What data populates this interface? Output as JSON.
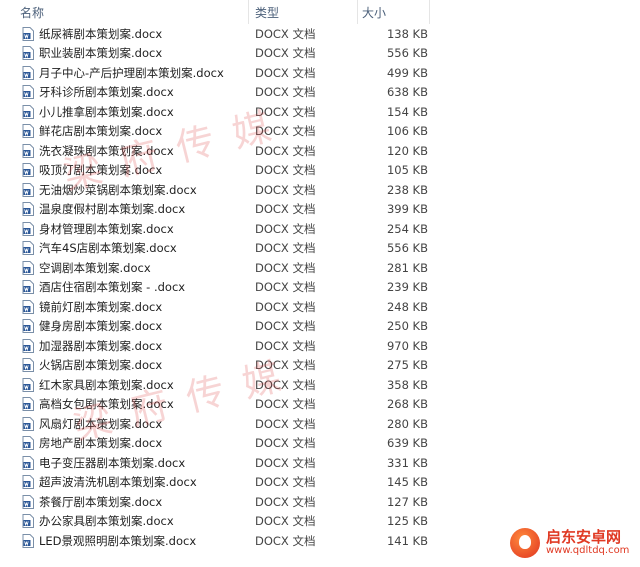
{
  "columns": {
    "name": "名称",
    "type": "类型",
    "size": "大小"
  },
  "files": [
    {
      "name": "纸尿裤剧本策划案.docx",
      "type": "DOCX 文档",
      "size": "138 KB"
    },
    {
      "name": "职业装剧本策划案.docx",
      "type": "DOCX 文档",
      "size": "556 KB"
    },
    {
      "name": "月子中心-产后护理剧本策划案.docx",
      "type": "DOCX 文档",
      "size": "499 KB"
    },
    {
      "name": "牙科诊所剧本策划案.docx",
      "type": "DOCX 文档",
      "size": "638 KB"
    },
    {
      "name": "小儿推拿剧本策划案.docx",
      "type": "DOCX 文档",
      "size": "154 KB"
    },
    {
      "name": "鲜花店剧本策划案.docx",
      "type": "DOCX 文档",
      "size": "106 KB"
    },
    {
      "name": "洗衣凝珠剧本策划案.docx",
      "type": "DOCX 文档",
      "size": "120 KB"
    },
    {
      "name": "吸顶灯剧本策划案.docx",
      "type": "DOCX 文档",
      "size": "105 KB"
    },
    {
      "name": "无油烟炒菜锅剧本策划案.docx",
      "type": "DOCX 文档",
      "size": "238 KB"
    },
    {
      "name": "温泉度假村剧本策划案.docx",
      "type": "DOCX 文档",
      "size": "399 KB"
    },
    {
      "name": "身材管理剧本策划案.docx",
      "type": "DOCX 文档",
      "size": "254 KB"
    },
    {
      "name": "汽车4S店剧本策划案.docx",
      "type": "DOCX 文档",
      "size": "556 KB"
    },
    {
      "name": "空调剧本策划案.docx",
      "type": "DOCX 文档",
      "size": "281 KB"
    },
    {
      "name": "酒店住宿剧本策划案 - .docx",
      "type": "DOCX 文档",
      "size": "239 KB"
    },
    {
      "name": "镜前灯剧本策划案.docx",
      "type": "DOCX 文档",
      "size": "248 KB"
    },
    {
      "name": "健身房剧本策划案.docx",
      "type": "DOCX 文档",
      "size": "250 KB"
    },
    {
      "name": "加湿器剧本策划案.docx",
      "type": "DOCX 文档",
      "size": "970 KB"
    },
    {
      "name": "火锅店剧本策划案.docx",
      "type": "DOCX 文档",
      "size": "275 KB"
    },
    {
      "name": "红木家具剧本策划案.docx",
      "type": "DOCX 文档",
      "size": "358 KB"
    },
    {
      "name": "高档女包剧本策划案.docx",
      "type": "DOCX 文档",
      "size": "268 KB"
    },
    {
      "name": "风扇灯剧本策划案.docx",
      "type": "DOCX 文档",
      "size": "280 KB"
    },
    {
      "name": "房地产剧本策划案.docx",
      "type": "DOCX 文档",
      "size": "639 KB"
    },
    {
      "name": "电子变压器剧本策划案.docx",
      "type": "DOCX 文档",
      "size": "331 KB"
    },
    {
      "name": "超声波清洗机剧本策划案.docx",
      "type": "DOCX 文档",
      "size": "145 KB"
    },
    {
      "name": "茶餐厅剧本策划案.docx",
      "type": "DOCX 文档",
      "size": "127 KB"
    },
    {
      "name": "办公家具剧本策划案.docx",
      "type": "DOCX 文档",
      "size": "125 KB"
    },
    {
      "name": "LED景观照明剧本策划案.docx",
      "type": "DOCX 文档",
      "size": "141 KB"
    }
  ],
  "watermarks": [
    "梁府传媒",
    "梁府传媒"
  ],
  "logo": {
    "main": "启东安卓网",
    "sub": "www.qdltdq.com"
  },
  "colors": {
    "doc_icon": "#2b5797",
    "watermark": "#dc3c3c",
    "logo": "#e03a24"
  }
}
